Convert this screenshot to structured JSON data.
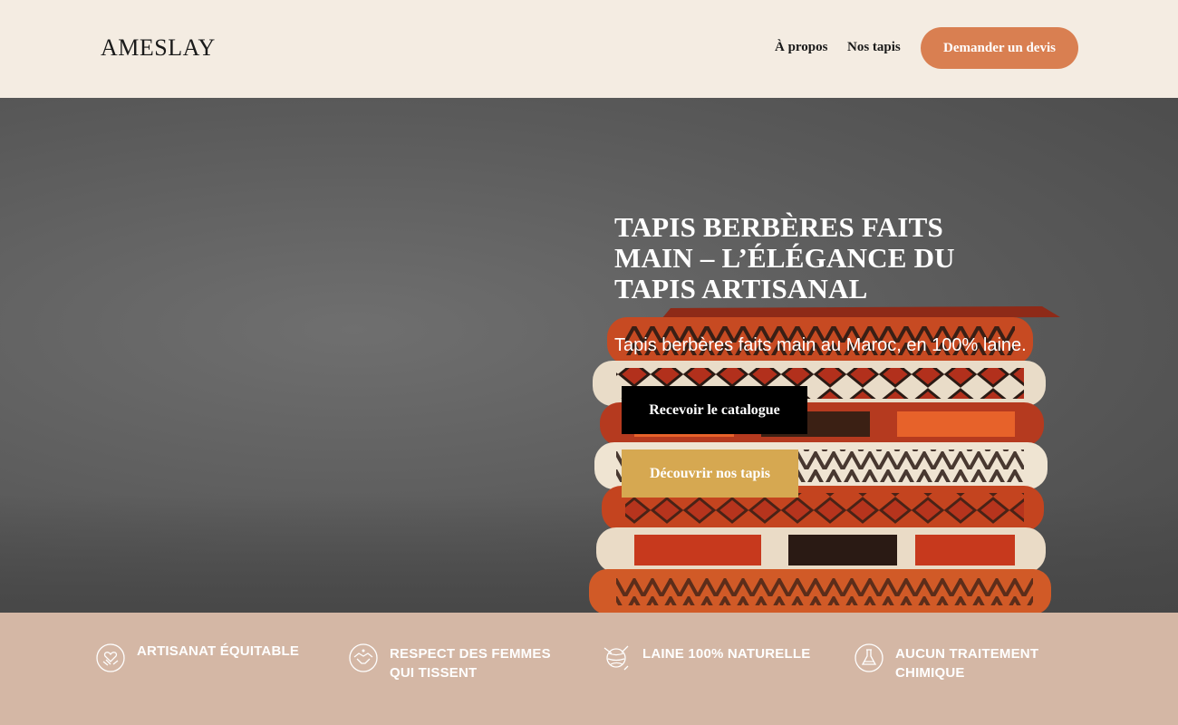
{
  "header": {
    "logo": "AMESLAY",
    "nav": {
      "about": "À propos",
      "rugs": "Nos tapis"
    },
    "cta_label": "Demander un devis"
  },
  "hero": {
    "title": "Tapis berbères faits main – L’élégance du tapis artisanal",
    "subtitle": "Tapis berbères faits main au Maroc, en 100% laine.",
    "catalog_button": "Recevoir le catalogue",
    "discover_button": "Découvrir nos tapis"
  },
  "features": [
    {
      "label": "Artisanat équitable",
      "icon": "handshake-heart-icon"
    },
    {
      "label": "Respect des femmes qui tissent",
      "icon": "handshake-icon"
    },
    {
      "label": "Laine 100% naturelle",
      "icon": "yarn-ball-icon"
    },
    {
      "label": "Aucun traitement chimique",
      "icon": "flask-icon"
    }
  ],
  "colors": {
    "background": "#f4ece2",
    "accent_orange": "#d97f51",
    "accent_gold": "#d6a851",
    "features_band": "#d4b7a5"
  }
}
